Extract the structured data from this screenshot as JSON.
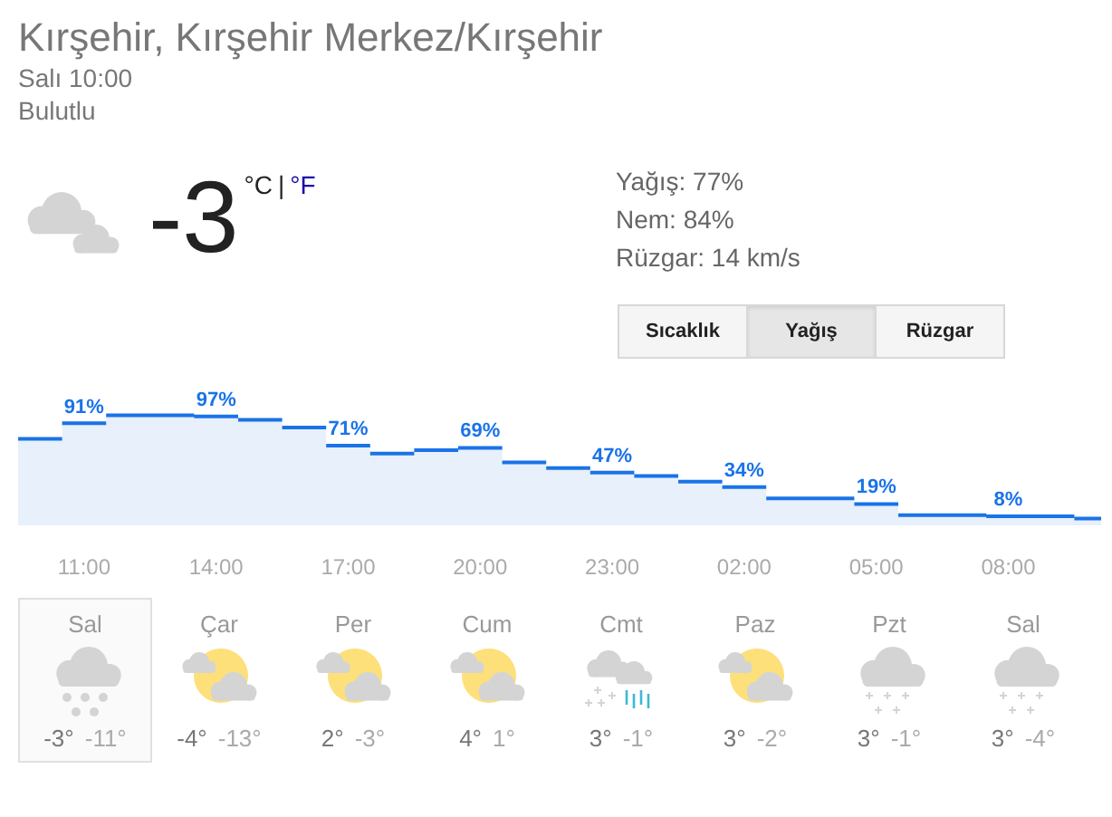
{
  "location": {
    "title": "Kırşehir, Kırşehir Merkez/Kırşehir",
    "time": "Salı 10:00",
    "condition": "Bulutlu"
  },
  "current": {
    "temperature": "-3",
    "units": [
      {
        "label": "°C",
        "selected": true
      },
      {
        "label": "°F",
        "selected": false
      }
    ],
    "separator": "|"
  },
  "details": [
    "Yağış: 77%",
    "Nem: 84%",
    "Rüzgar: 14 km/s"
  ],
  "tabs": [
    {
      "label": "Sıcaklık",
      "selected": false
    },
    {
      "label": "Yağış",
      "selected": true
    },
    {
      "label": "Rüzgar",
      "selected": false
    }
  ],
  "chart": {
    "percent_labels": [
      "91%",
      "97%",
      "71%",
      "69%",
      "47%",
      "34%",
      "19%",
      "8%"
    ],
    "hours": [
      "11:00",
      "14:00",
      "17:00",
      "20:00",
      "23:00",
      "02:00",
      "05:00",
      "08:00"
    ]
  },
  "days": [
    {
      "day": "Sal",
      "kind": "snow",
      "high": "-3°",
      "low": "-11°",
      "selected": true
    },
    {
      "day": "Çar",
      "kind": "partly_cloudy",
      "high": "-4°",
      "low": "-13°",
      "selected": false
    },
    {
      "day": "Per",
      "kind": "partly_cloudy",
      "high": "2°",
      "low": "-3°",
      "selected": false
    },
    {
      "day": "Cum",
      "kind": "partly_cloudy",
      "high": "4°",
      "low": "1°",
      "selected": false
    },
    {
      "day": "Cmt",
      "kind": "mixed",
      "high": "3°",
      "low": "-1°",
      "selected": false
    },
    {
      "day": "Paz",
      "kind": "partly_cloudy",
      "high": "3°",
      "low": "-2°",
      "selected": false
    },
    {
      "day": "Pzt",
      "kind": "flurries",
      "high": "3°",
      "low": "-1°",
      "selected": false
    },
    {
      "day": "Sal",
      "kind": "flurries",
      "high": "3°",
      "low": "-4°",
      "selected": false
    }
  ]
}
